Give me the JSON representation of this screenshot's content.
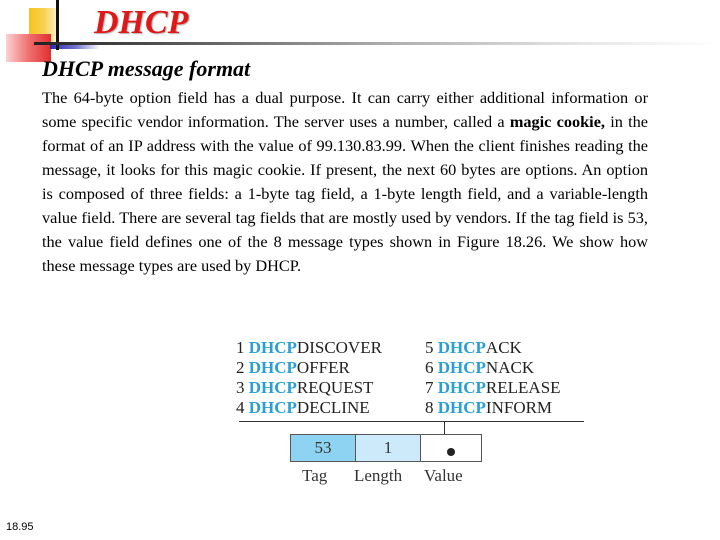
{
  "slide": {
    "title": "DHCP",
    "subtitle": "DHCP message format",
    "body": {
      "part1": "The 64-byte option field has a dual purpose. It can carry either additional information or some specific vendor information. The server uses a number, called a ",
      "bold": "magic cookie,",
      "part2": " in the format of an IP address with the value of 99.130.83.99. When the client finishes reading the message, it looks for this magic cookie. If present, the next 60 bytes are options. An option is composed of three fields: a 1-byte tag field, a 1-byte length field, and a variable-length value field. There are several tag fields that are mostly used by vendors. If the tag field is 53, the value field defines one of the 8 message types shown in Figure 18.26. We show how these message types are used by DHCP."
    },
    "page_number": "18.95"
  },
  "figure": {
    "message_types": [
      {
        "num": "1",
        "prefix": "DHCP",
        "suffix": "DISCOVER"
      },
      {
        "num": "2",
        "prefix": "DHCP",
        "suffix": "OFFER"
      },
      {
        "num": "3",
        "prefix": "DHCP",
        "suffix": "REQUEST"
      },
      {
        "num": "4",
        "prefix": "DHCP",
        "suffix": "DECLINE"
      },
      {
        "num": "5",
        "prefix": "DHCP",
        "suffix": "ACK"
      },
      {
        "num": "6",
        "prefix": "DHCP",
        "suffix": "NACK"
      },
      {
        "num": "7",
        "prefix": "DHCP",
        "suffix": "RELEASE"
      },
      {
        "num": "8",
        "prefix": "DHCP",
        "suffix": "INFORM"
      }
    ],
    "fields": {
      "tag_value": "53",
      "length_value": "1",
      "tag_label": "Tag",
      "length_label": "Length",
      "value_label": "Value"
    },
    "colors": {
      "prefix": "#2a9fd6",
      "tag_fill": "#8fd3f2",
      "length_fill": "#cdeafa",
      "title": "#e01818"
    }
  }
}
